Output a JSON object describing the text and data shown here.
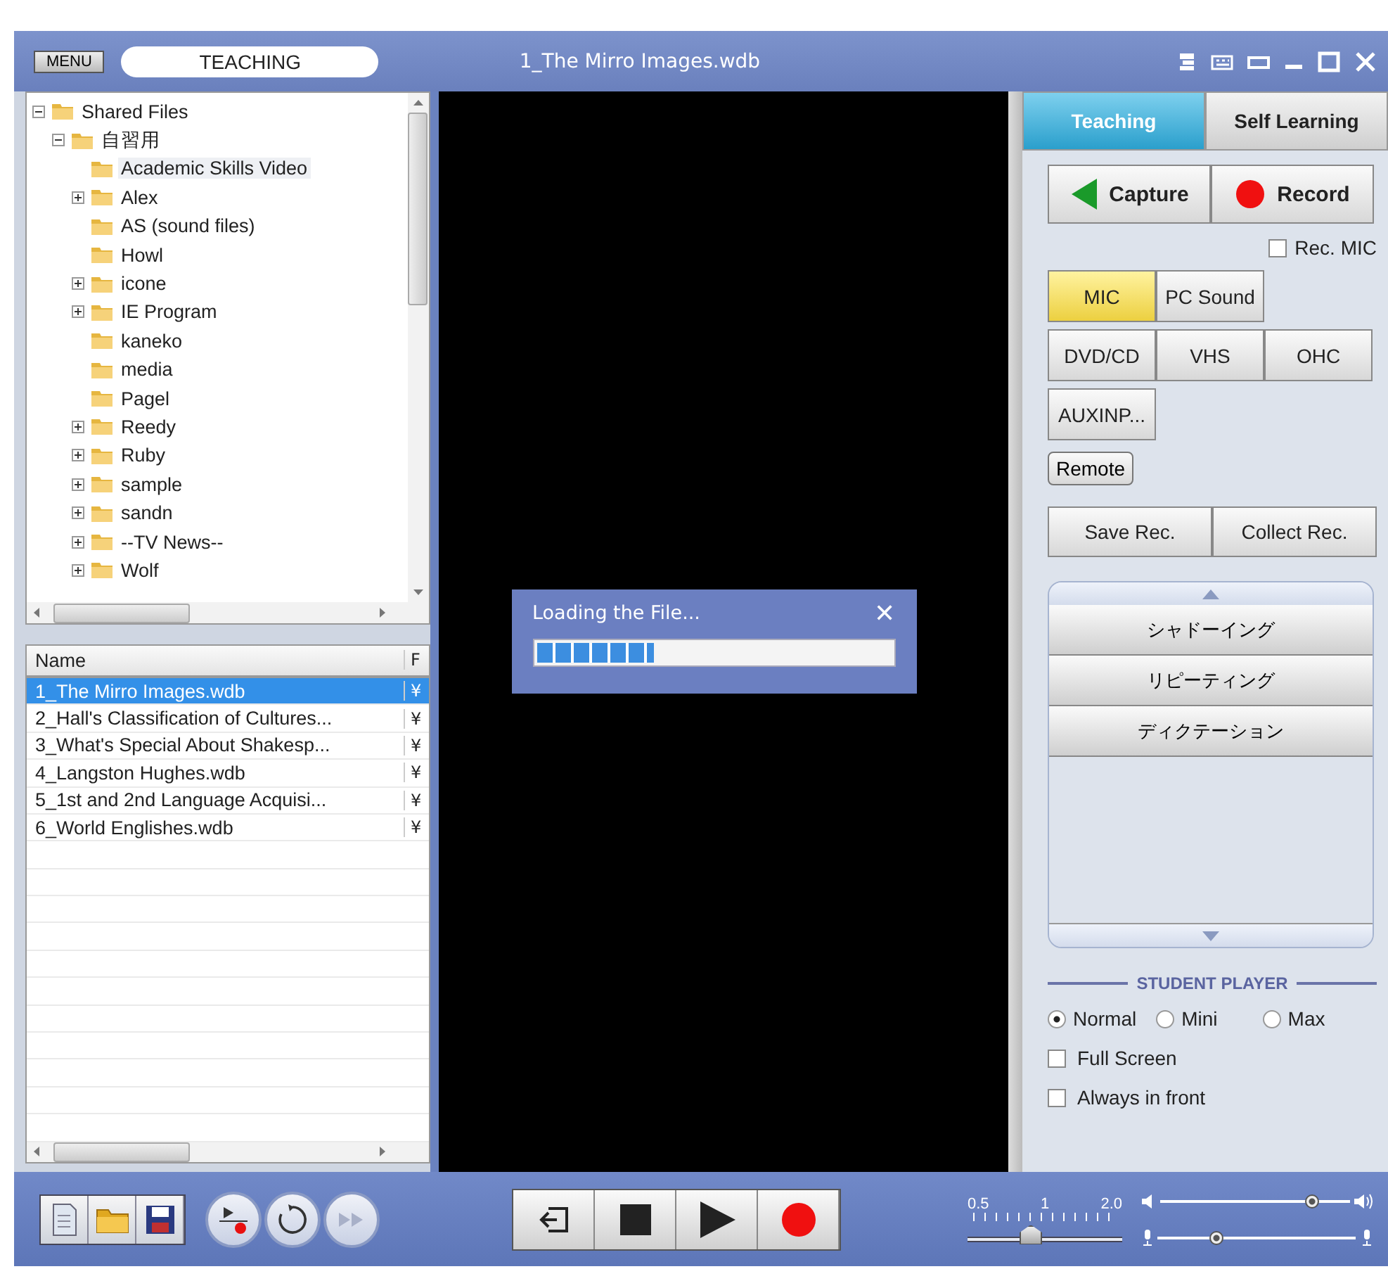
{
  "header": {
    "menu_button": "MENU",
    "mode": "TEACHING",
    "title": "1_The Mirro Images.wdb"
  },
  "tree": [
    {
      "label": "Shared Files",
      "kind": "branch",
      "expanded": true,
      "selected": false,
      "children": [
        {
          "label": "自習用",
          "kind": "branch",
          "expanded": true,
          "selected": false,
          "children": [
            {
              "label": "Academic Skills Video",
              "kind": "leaf",
              "selected": true
            },
            {
              "label": "Alex",
              "kind": "branch",
              "expanded": false,
              "selected": false
            },
            {
              "label": "AS (sound files)",
              "kind": "leaf",
              "selected": false
            },
            {
              "label": "Howl",
              "kind": "leaf",
              "selected": false
            },
            {
              "label": "icone",
              "kind": "branch",
              "expanded": false,
              "selected": false
            },
            {
              "label": "IE Program",
              "kind": "branch",
              "expanded": false,
              "selected": false
            },
            {
              "label": "kaneko",
              "kind": "leaf",
              "selected": false
            },
            {
              "label": "media",
              "kind": "leaf",
              "selected": false
            },
            {
              "label": "Pagel",
              "kind": "leaf",
              "selected": false
            },
            {
              "label": "Reedy",
              "kind": "branch",
              "expanded": false,
              "selected": false
            },
            {
              "label": "Ruby",
              "kind": "branch",
              "expanded": false,
              "selected": false
            },
            {
              "label": "sample",
              "kind": "branch",
              "expanded": false,
              "selected": false
            },
            {
              "label": "sandn",
              "kind": "branch",
              "expanded": false,
              "selected": false
            },
            {
              "label": "--TV News--",
              "kind": "branch",
              "expanded": false,
              "selected": false
            },
            {
              "label": "Wolf",
              "kind": "branch",
              "expanded": false,
              "selected": false
            }
          ]
        }
      ]
    }
  ],
  "file_list": {
    "columns": [
      "Name",
      "F"
    ],
    "rows": [
      {
        "name": "1_The Mirro Images.wdb",
        "column_2": "¥",
        "selected": true
      },
      {
        "name": "2_Hall's Classification of Cultures...",
        "column_2": "¥",
        "selected": false
      },
      {
        "name": "3_What's Special About Shakesp...",
        "column_2": "¥",
        "selected": false
      },
      {
        "name": "4_Langston Hughes.wdb",
        "column_2": "¥",
        "selected": false
      },
      {
        "name": "5_1st and 2nd Language Acquisi...",
        "column_2": "¥",
        "selected": false
      },
      {
        "name": "6_World Englishes.wdb",
        "column_2": "¥",
        "selected": false
      }
    ]
  },
  "loading_dialog": {
    "title": "Loading the File...",
    "close": "✕",
    "level": 0.33
  },
  "tabs": [
    {
      "label": "Teaching",
      "selected": true
    },
    {
      "label": "Self Learning",
      "selected": false
    }
  ],
  "capture_button": "Capture",
  "record_button": "Record",
  "rec_mic": {
    "label": "Rec. MIC",
    "checked": false
  },
  "sources": [
    [
      {
        "label": "MIC",
        "selected": true
      },
      {
        "label": "PC Sound",
        "selected": false
      }
    ],
    [
      {
        "label": "DVD/CD",
        "selected": false
      },
      {
        "label": "VHS",
        "selected": false
      },
      {
        "label": "OHC",
        "selected": false
      }
    ],
    [
      {
        "label": "AUXINP...",
        "selected": false
      }
    ]
  ],
  "remote_button": "Remote",
  "rec_buttons": [
    "Save Rec.",
    "Collect Rec."
  ],
  "practice_modes": [
    "シャドーイング",
    "リピーティング",
    "ディクテーション"
  ],
  "student_player": {
    "heading": "STUDENT PLAYER",
    "sizes": [
      {
        "label": "Normal",
        "selected": true
      },
      {
        "label": "Mini",
        "selected": false
      },
      {
        "label": "Max",
        "selected": false
      }
    ],
    "options": [
      {
        "label": "Full Screen",
        "checked": false
      },
      {
        "label": "Always in front",
        "checked": false
      }
    ]
  },
  "speed": {
    "ticks": [
      "0.5",
      "1",
      "2.0"
    ],
    "level": 0.4
  },
  "speaker_volume": {
    "level": 0.8
  },
  "mic_volume": {
    "level": 0.3
  }
}
